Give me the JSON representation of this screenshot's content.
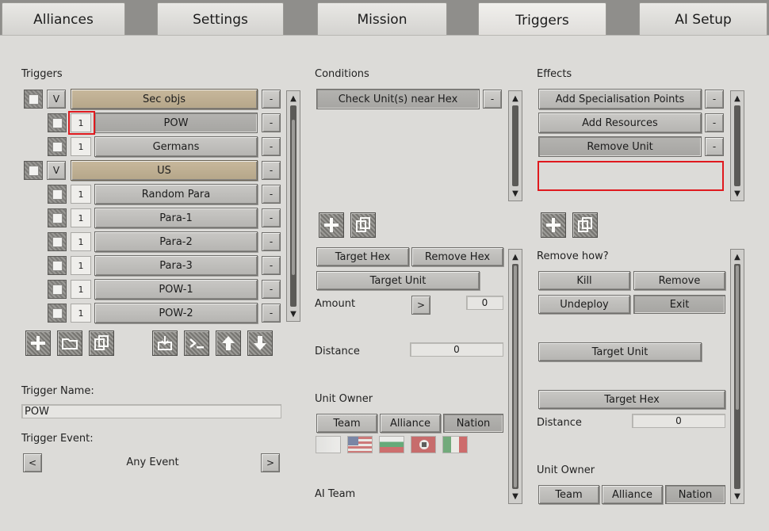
{
  "tabs": [
    "Alliances",
    "Settings",
    "Mission",
    "Triggers",
    "AI Setup"
  ],
  "active_tab": "Triggers",
  "triggers": {
    "header": "Triggers",
    "rows": [
      {
        "type": "group",
        "check_label": "",
        "v_label": "V",
        "label": "Sec objs",
        "minus": "-"
      },
      {
        "type": "item",
        "count": "1",
        "label": "POW",
        "minus": "-"
      },
      {
        "type": "item",
        "count": "1",
        "label": "Germans",
        "minus": "-"
      },
      {
        "type": "group",
        "check_label": "",
        "v_label": "V",
        "label": "US",
        "minus": "-"
      },
      {
        "type": "item",
        "count": "1",
        "label": "Random Para",
        "minus": "-"
      },
      {
        "type": "item",
        "count": "1",
        "label": "Para-1",
        "minus": "-"
      },
      {
        "type": "item",
        "count": "1",
        "label": "Para-2",
        "minus": "-"
      },
      {
        "type": "item",
        "count": "1",
        "label": "Para-3",
        "minus": "-"
      },
      {
        "type": "item",
        "count": "1",
        "label": "POW-1",
        "minus": "-"
      },
      {
        "type": "item",
        "count": "1",
        "label": "POW-2",
        "minus": "-"
      }
    ],
    "toolbar_icons": [
      "add-icon",
      "folder-icon",
      "copy-icon",
      "import-icon",
      "console-icon",
      "move-up-icon",
      "move-down-icon"
    ],
    "name_label": "Trigger Name:",
    "name_value": "POW",
    "event_label": "Trigger Event:",
    "event_prev": "<",
    "event_value": "Any Event",
    "event_next": ">"
  },
  "conditions": {
    "header": "Conditions",
    "items": [
      {
        "label": "Check Unit(s) near Hex",
        "minus": "-"
      }
    ],
    "target_hex": "Target Hex",
    "remove_hex": "Remove Hex",
    "target_unit": "Target Unit",
    "amount_label": "Amount",
    "amount_arrow": ">",
    "amount_value": "0",
    "distance_label": "Distance",
    "distance_value": "0",
    "unit_owner_label": "Unit Owner",
    "owner_buttons": [
      "Team",
      "Alliance",
      "Nation"
    ],
    "flags": [
      "blank-flag",
      "us-flag",
      "bulgaria-flag",
      "germany-flag",
      "italy-flag"
    ],
    "ai_team_label": "AI Team"
  },
  "effects": {
    "header": "Effects",
    "items": [
      {
        "label": "Add Specialisation Points",
        "minus": "-"
      },
      {
        "label": "Add Resources",
        "minus": "-"
      },
      {
        "label": "Remove Unit",
        "minus": "-"
      }
    ],
    "remove_how_label": "Remove how?",
    "remove_how_buttons": [
      "Kill",
      "Remove",
      "Undeploy",
      "Exit"
    ],
    "target_unit": "Target Unit",
    "target_hex": "Target Hex",
    "distance_label": "Distance",
    "distance_value": "0",
    "unit_owner_label": "Unit Owner",
    "owner_buttons": [
      "Team",
      "Alliance",
      "Nation"
    ]
  },
  "colors": {
    "group_row": "#c2b396",
    "highlight": "#e0191e"
  }
}
